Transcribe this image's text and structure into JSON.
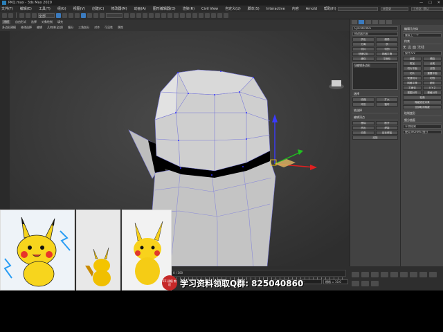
{
  "window": {
    "title": "PKQ.max - 3ds Max 2020",
    "controls": [
      "—",
      "□",
      "✕"
    ]
  },
  "menu": {
    "items": [
      "文件(F)",
      "编辑(E)",
      "工具(T)",
      "组(G)",
      "视图(V)",
      "创建(C)",
      "修改器(M)",
      "动画(A)",
      "图形编辑器(D)",
      "渲染(R)",
      "Civil View",
      "自定义(U)",
      "脚本(S)",
      "Interactive",
      "内容",
      "Arnold",
      "帮助(H)"
    ],
    "user_label": "未登录",
    "workspace_label": "工作区: 默认"
  },
  "toolbar": {
    "selection_filter": "全部"
  },
  "ribbon": {
    "tabs_row1": [
      "建模",
      "自由形式",
      "选择",
      "对象绘制",
      "填充"
    ],
    "tabs_row2": [
      "多边形建模",
      "修改选择",
      "编辑",
      "几何体(全部)",
      "细分",
      "三角剖分",
      "对齐",
      "可见性",
      "属性"
    ]
  },
  "viewport": {
    "label": "[+] [正交] [标准] [默认明暗处理]"
  },
  "command_panel": {
    "object_name": "Cylinder001",
    "modifier_list_label": "修改器列表",
    "left_buttons": [
      [
        "挤出",
        "倒角"
      ],
      [
        "分离",
        "桥"
      ],
      [
        "切片",
        "切割"
      ],
      [
        "快速切片",
        "网格平滑"
      ],
      [
        "细化",
        "平面化"
      ]
    ],
    "stack_items": [
      "可编辑多边形"
    ],
    "selection_section": "选择",
    "selection_rows": [
      [
        "收缩",
        "扩大"
      ],
      [
        "环形",
        "循环"
      ]
    ],
    "soft_selection": "软选择",
    "edit_vertices": "编辑顶点",
    "edit_vertex_buttons": [
      [
        "移除",
        "断开"
      ],
      [
        "挤出",
        "焊接"
      ],
      [
        "切角",
        "目标焊接"
      ],
      [
        "连接",
        ""
      ]
    ],
    "edit_geometry": "编辑几何体",
    "repeat_last": "重复上一个",
    "constraints_label": "约束",
    "constraint_options": [
      "无",
      "边",
      "面",
      "法线"
    ],
    "keep_uv": "保持 UV",
    "right_buttons": [
      [
        "创建",
        "塌陷"
      ],
      [
        "附加",
        "分离"
      ],
      [
        "切片平面",
        "分割"
      ],
      [
        "切片",
        "重置平面"
      ],
      [
        "快速切片",
        "切割"
      ],
      [
        "网格平滑",
        "细化"
      ],
      [
        "平面化",
        "X Y Z"
      ],
      [
        "视图对齐",
        "栅格对齐"
      ],
      [
        "松弛",
        ""
      ],
      [
        "隐藏选定对象",
        ""
      ],
      [
        "全部取消隐藏",
        ""
      ]
    ],
    "paint_deformation": "绘制变形",
    "subdivision_surface": "细分曲面",
    "smooth_result": "平滑结果",
    "use_nurms": "使用 NURMS 细分"
  },
  "status": {
    "frame_label": "0 / 100",
    "x_label": "X: -",
    "y_label": "Y: -",
    "z_label": "Z: -",
    "grid_label": "栅格 = 10.0",
    "auto_key": "自动关键点",
    "selected": "选定对象"
  },
  "banner": {
    "logo_text": "ZZ 建模 教程",
    "text": "学习资料领取Q群: 825040860"
  },
  "colors": {
    "accent": "#3b7bbf",
    "viewport_bg": "#3a3a3a",
    "mesh_face": "#c9c9c9",
    "mesh_edge": "#7b7bd8",
    "vertex": "#3030ff"
  }
}
